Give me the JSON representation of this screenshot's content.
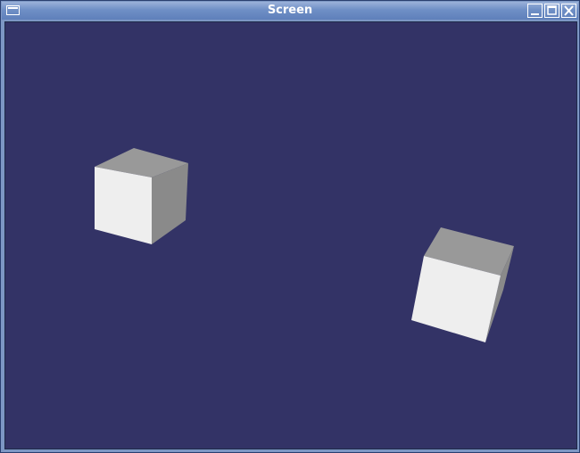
{
  "window": {
    "title": "Screen"
  },
  "icons": {
    "menu": "window-menu-icon",
    "minimize": "minimize-icon",
    "maximize": "maximize-icon",
    "close": "close-icon"
  },
  "colors": {
    "viewport_background": "#333366",
    "titlebar": "#6f8fc6",
    "cube_front": "#eeeeee",
    "cube_top": "#999999",
    "cube_side": "#8a8a8a"
  }
}
